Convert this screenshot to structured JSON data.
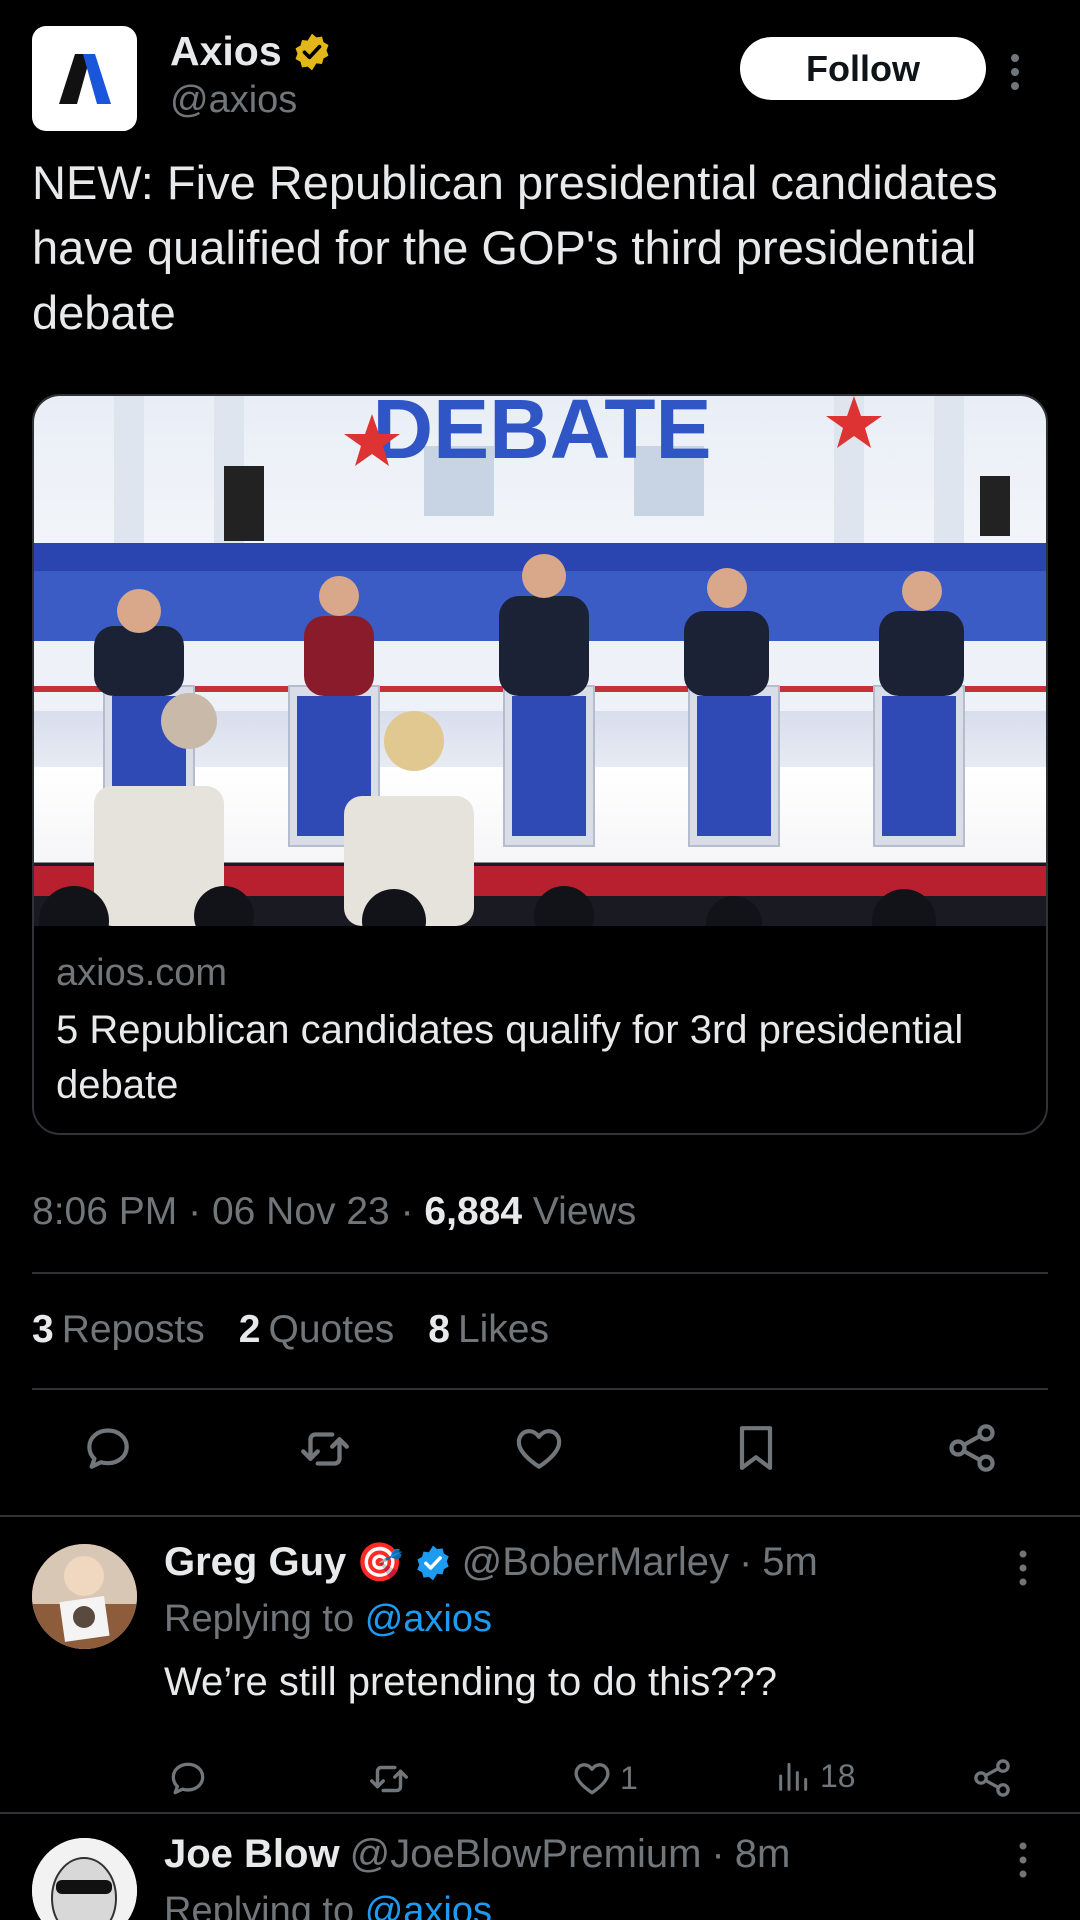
{
  "tweet": {
    "author": {
      "display_name": "Axios",
      "handle": "@axios",
      "verified": "gold-checkmark"
    },
    "follow_label": "Follow",
    "text": "NEW: Five Republican presidential candidates have qualified for the GOP's third presidential debate",
    "card": {
      "image_description_icon": "debate-stage-photo",
      "domain": "axios.com",
      "title": "5 Republican candidates qualify for 3rd presidential debate",
      "banner_text": "DEBATE"
    },
    "time": "8:06 PM",
    "date": "06 Nov 23",
    "views_count": "6,884",
    "views_label": "Views",
    "stats": {
      "reposts_count": "3",
      "reposts_label": "Reposts",
      "quotes_count": "2",
      "quotes_label": "Quotes",
      "likes_count": "8",
      "likes_label": "Likes"
    }
  },
  "replies": [
    {
      "name": "Greg Guy",
      "emoji": "🎯",
      "handle": "@BoberMarley",
      "time": "5m",
      "replying_to_label": "Replying to",
      "replying_to": "@axios",
      "text": "We’re still pretending to do this???",
      "likes": "1",
      "views": "18"
    },
    {
      "name": "Joe Blow",
      "handle": "@JoeBlowPremium",
      "time": "8m",
      "replying_to_label": "Replying to",
      "replying_to": "@axios"
    }
  ],
  "separator_dot": "·",
  "colors": {
    "background": "#000000",
    "text": "#e7e9ea",
    "secondary": "#71767b",
    "accent": "#1d9bf0",
    "gold": "#e2b719"
  }
}
